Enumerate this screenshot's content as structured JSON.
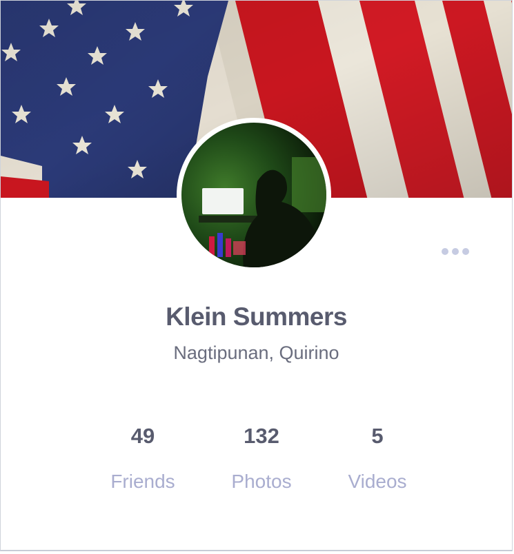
{
  "profile": {
    "name": "Klein Summers",
    "location": "Nagtipunan, Quirino",
    "cover_image": "american-flag",
    "avatar_image": "person-at-dark-desk"
  },
  "stats": [
    {
      "value": "49",
      "label": "Friends"
    },
    {
      "value": "132",
      "label": "Photos"
    },
    {
      "value": "5",
      "label": "Videos"
    }
  ],
  "menu": {
    "icon": "more-horizontal-icon"
  },
  "colors": {
    "name_text": "#585b6e",
    "location_text": "#6a6d7e",
    "stat_label": "#a9adcf",
    "more_dots": "#c6cbe2"
  }
}
